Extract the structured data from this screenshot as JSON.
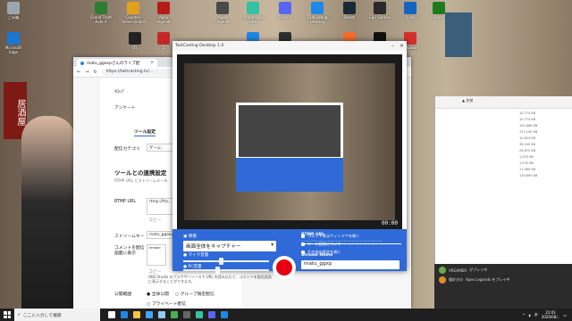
{
  "desktop": {
    "icons": [
      {
        "label": "ごみ箱",
        "icon": "recycle-bin-icon",
        "color": "#9aa7b0"
      },
      {
        "label": "Grand Theft Auto V",
        "icon": "gta-icon",
        "color": "#2e7d32"
      },
      {
        "label": "Counter-Strike Global Offensive",
        "icon": "csgo-icon",
        "color": "#e0a020"
      },
      {
        "label": "Apex Legends",
        "icon": "apex-icon",
        "color": "#b71c1c"
      },
      {
        "label": "Apex Legends",
        "icon": "apex-icon-2",
        "color": "#4a4a4a"
      },
      {
        "label": "StreamLabs OBS",
        "icon": "streamlabs-icon",
        "color": "#31c3a2"
      },
      {
        "label": "Discord",
        "icon": "discord-icon",
        "color": "#5865f2"
      },
      {
        "label": "TwitCasting Desktop",
        "icon": "twitcasting-icon",
        "color": "#1e88e5"
      },
      {
        "label": "Steam",
        "icon": "steam-icon",
        "color": "#1b2838"
      },
      {
        "label": "Epic Games",
        "icon": "epic-games-icon",
        "color": "#2a2a2a"
      },
      {
        "label": "Uplay",
        "icon": "uplay-icon",
        "color": "#1565c0"
      },
      {
        "label": "Razer",
        "icon": "razer-icon",
        "color": "#1e7a1e"
      },
      {
        "label": "Microsoft Edge",
        "icon": "edge-icon",
        "color": "#1976d2"
      },
      {
        "label": "DS",
        "icon": "ds-icon",
        "color": "#222222"
      },
      {
        "label": "Z",
        "icon": "z-icon",
        "color": "#c62828"
      },
      {
        "label": "Kindle",
        "icon": "kindle-icon",
        "color": "#1e88e5"
      },
      {
        "label": "OBS Studio",
        "icon": "obs-icon",
        "color": "#303030"
      },
      {
        "label": "Origin",
        "icon": "origin-icon",
        "color": "#f56c2d"
      },
      {
        "label": "Xbox",
        "icon": "xbox-icon",
        "color": "#2e7d32"
      },
      {
        "label": "EPIC",
        "icon": "epic-icon",
        "color": "#111111"
      },
      {
        "label": "Opera",
        "icon": "opera-icon",
        "color": "#d32f2f"
      }
    ],
    "wallpaper_sign": "居酒屋"
  },
  "browser": {
    "tab_title": "matu_ggexpさんのライブ配",
    "url": "https://twitcasting.tv/...",
    "rows": {
      "topbar": "ｸﾛｯﾌﾟ",
      "survey": "アンケート",
      "tool_settings": "ツール設定",
      "category": "配信カテゴリ",
      "category_value": "ゲーム：",
      "section_title": "ツールとの連携設定",
      "section_desc": "RTMP URL とストリームキーを",
      "rtmp_url": "RTMP URL",
      "rtmp_value": "rtmp://ttv...",
      "copy": "コピー",
      "stream_key": "ストリームキー",
      "stream_key_value": "matu_ggexp",
      "comment_embed": "コメントを配信画面に表示",
      "comment_note": "OBS Studio のブラウザーソースで URL を読み込むと、コメントを配信画面に表示することができます。",
      "copy2": "コピー",
      "scope": "公開範囲",
      "scope_all": "全体公開",
      "scope_group": "グループ限定配信",
      "scope_private": "プライベート配信"
    }
  },
  "twitcasting": {
    "title": "TwitCasting Desktop 1.0",
    "elapsed": "00:00",
    "video_label": "映像",
    "video_source": "画面全体をキャプチャー",
    "mic_label": "マイク音量",
    "pc_label": "PC音量",
    "mic_level": 0.42,
    "pc_level": 0.38,
    "rtmp_label": "RTMP URL",
    "rtmp_value": "••••••••••••••••••••••••••••••••••••••••",
    "stream_name_label": "Stream Name",
    "stream_name_value": "matu_ggxp",
    "link_comment": "コメント表示ウィンドウを開く",
    "link_about": "ツール配信について",
    "link_other": "その他の設定を開く"
  },
  "explorer": {
    "header": "▲ 名前",
    "sizes": [
      "10,774 KB",
      "10,774 KB",
      "101,668 KB",
      "171,190 KB",
      "10,624 KB",
      "36,240 KB",
      "26,672 KB",
      "1,533 KB",
      "1,533 KB",
      "11,460 KB",
      "130,690 KB"
    ]
  },
  "chat": {
    "lines": [
      {
        "name": "VRGAMER",
        "text": "がプレイ中"
      },
      {
        "name": "猫好きの",
        "text": "Apex Legends をプレイ中"
      }
    ]
  },
  "taskbar": {
    "search_placeholder": "ここに入力して検索",
    "time": "21:01",
    "date": "2020/06/..",
    "ime": "あ",
    "apps": [
      {
        "icon": "task-view-icon",
        "color": "#ffffff"
      },
      {
        "icon": "edge-taskbar-icon",
        "color": "#1e88e5"
      },
      {
        "icon": "explorer-taskbar-icon",
        "color": "#f6c343"
      },
      {
        "icon": "store-taskbar-icon",
        "color": "#42a5f5"
      },
      {
        "icon": "mail-taskbar-icon",
        "color": "#90caf9"
      },
      {
        "icon": "chrome-taskbar-icon",
        "color": "#4caf50"
      },
      {
        "icon": "obs-taskbar-icon",
        "color": "#666666"
      },
      {
        "icon": "streamlabs-taskbar-icon",
        "color": "#31c3a2"
      },
      {
        "icon": "discord-taskbar-icon",
        "color": "#5865f2"
      },
      {
        "icon": "twitcasting-taskbar-icon",
        "color": "#1e88e5"
      }
    ]
  }
}
